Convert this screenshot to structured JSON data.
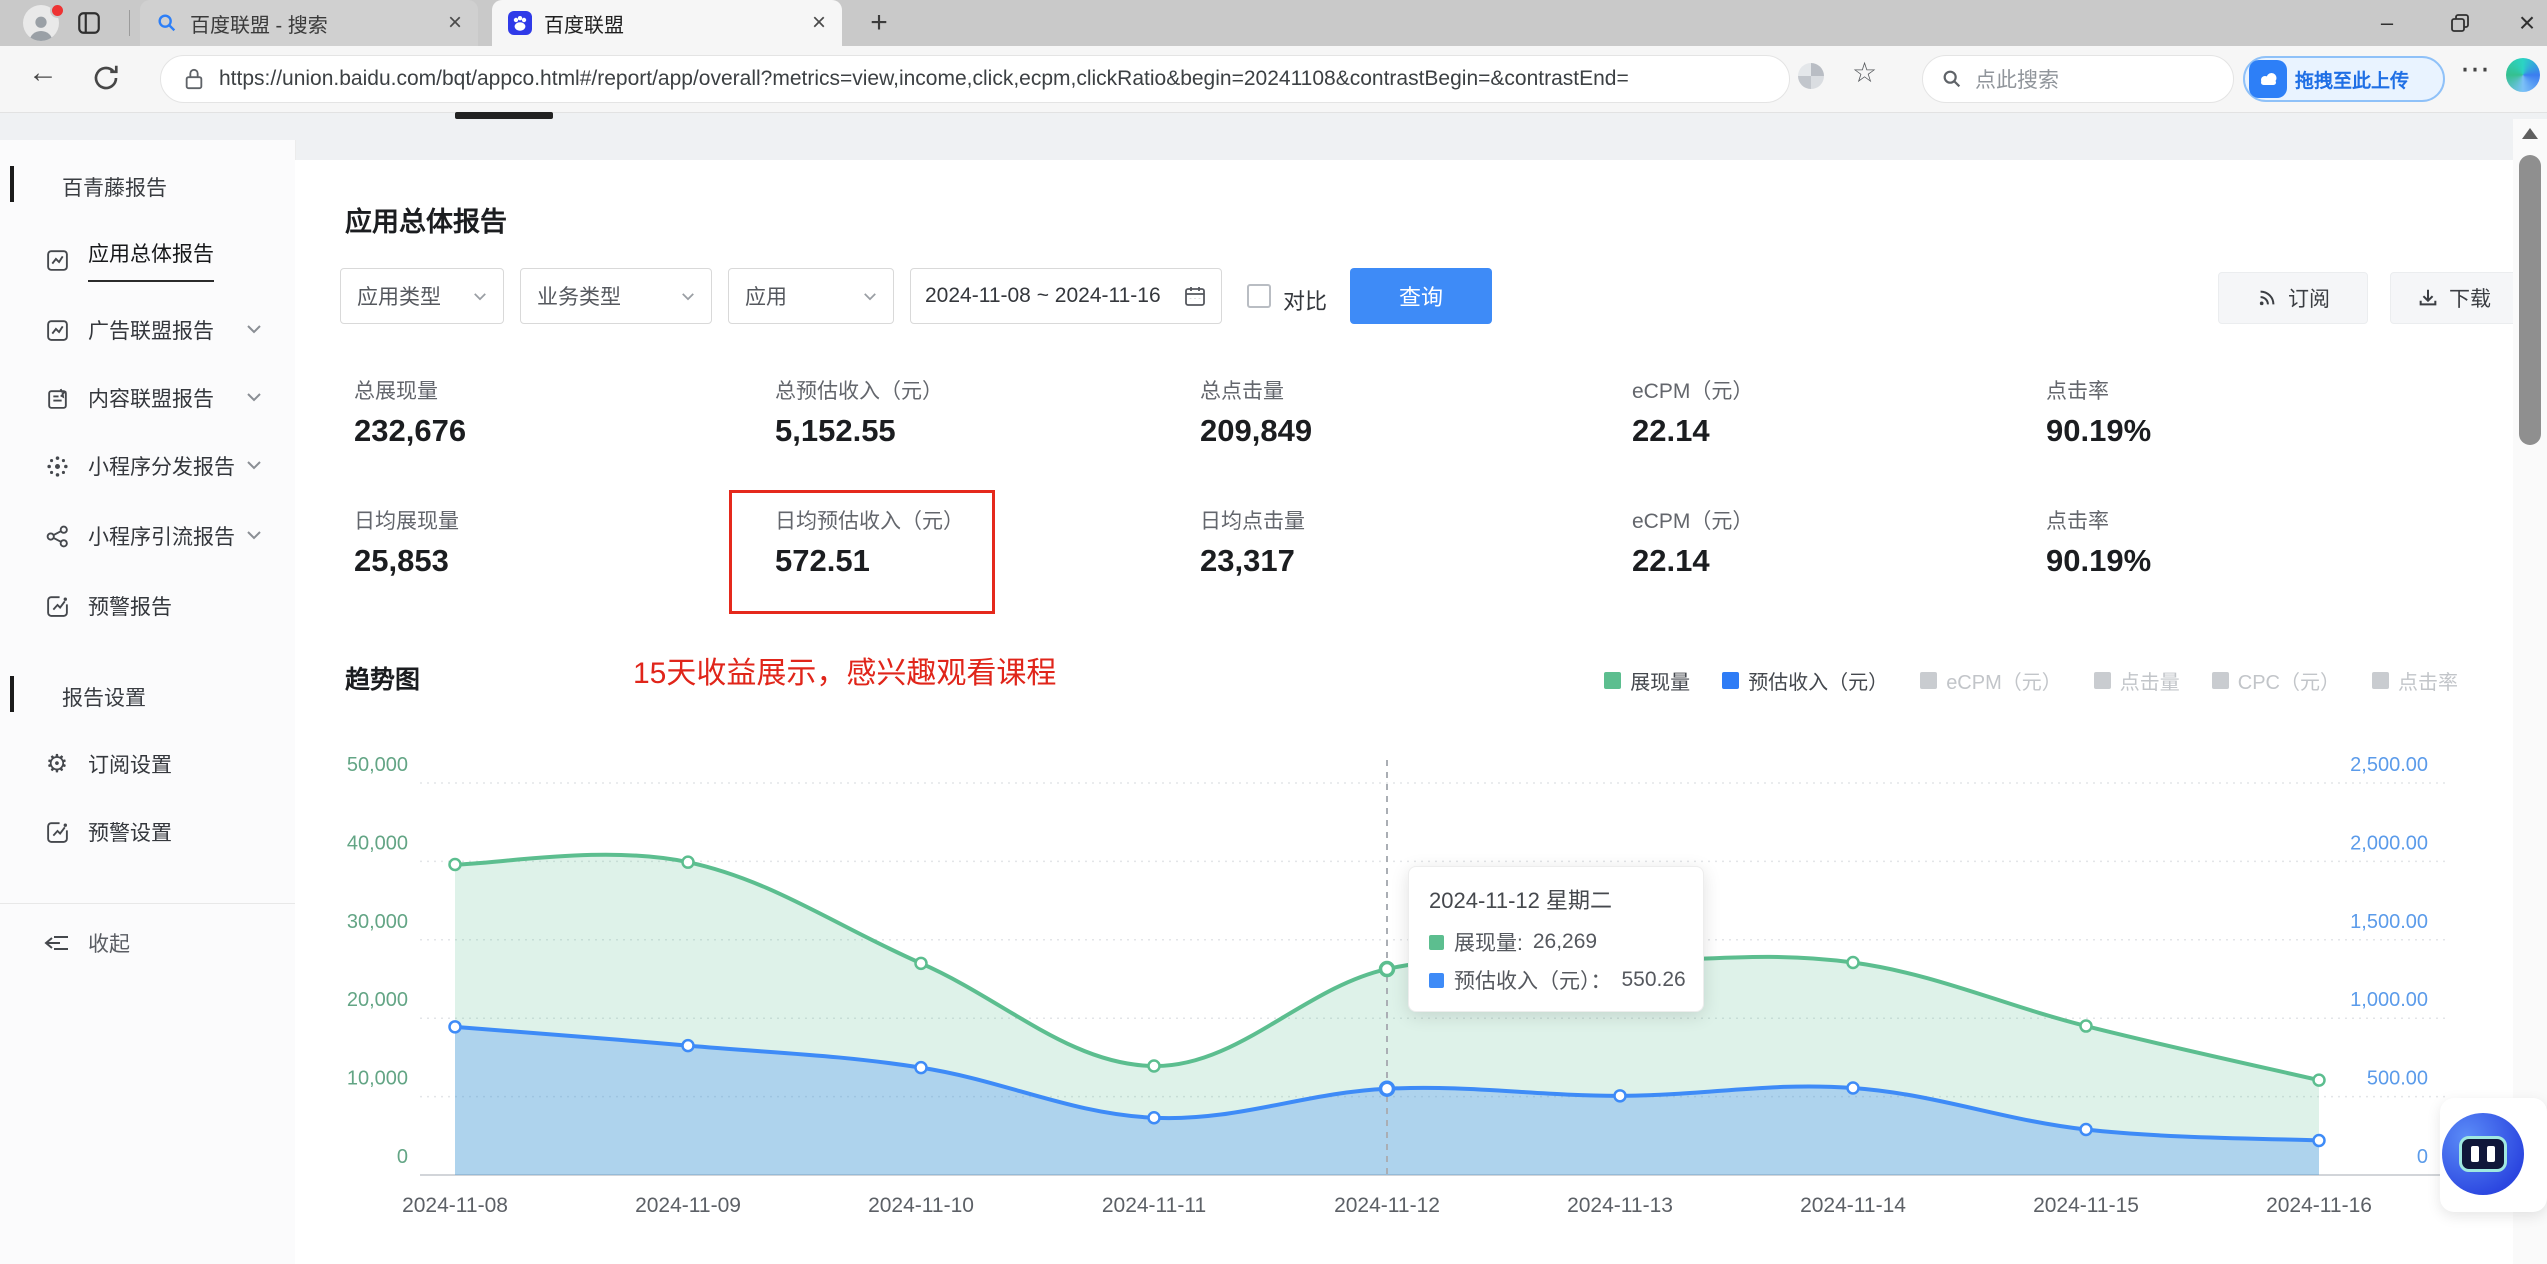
{
  "browser": {
    "tabs": [
      {
        "title": "百度联盟 - 搜索"
      },
      {
        "title": "百度联盟"
      }
    ],
    "url": "https://union.baidu.com/bqt/appco.html#/report/app/overall?metrics=view,income,click,ecpm,clickRatio&begin=20241108&contrastBegin=&contrastEnd=",
    "search_placeholder": "点此搜索",
    "upload_button": "拖拽至此上传",
    "window_controls": {
      "minimize": "–",
      "restore": "",
      "close": "×"
    },
    "new_tab": "+",
    "close_tab": "×",
    "back": "←",
    "more": "⋯",
    "star": "☆"
  },
  "sidebar": {
    "group1": "百青藤报告",
    "items": [
      {
        "label": "应用总体报告"
      },
      {
        "label": "广告联盟报告"
      },
      {
        "label": "内容联盟报告"
      },
      {
        "label": "小程序分发报告"
      },
      {
        "label": "小程序引流报告"
      },
      {
        "label": "预警报告"
      }
    ],
    "group2": "报告设置",
    "settings_items": [
      {
        "label": "订阅设置"
      },
      {
        "label": "预警设置"
      }
    ],
    "collapse": "收起"
  },
  "main": {
    "title": "应用总体报告",
    "filters": {
      "app_type": "应用类型",
      "biz_type": "业务类型",
      "app": "应用",
      "date_range": "2024-11-08 ~ 2024-11-16",
      "compare_label": "对比",
      "query_label": "查询"
    },
    "actions": {
      "subscribe": "订阅",
      "download": "下载"
    },
    "stats_row1": [
      {
        "label": "总展现量",
        "value": "232,676"
      },
      {
        "label": "总预估收入（元）",
        "value": "5,152.55"
      },
      {
        "label": "总点击量",
        "value": "209,849"
      },
      {
        "label": "eCPM（元）",
        "value": "22.14"
      },
      {
        "label": "点击率",
        "value": "90.19%"
      }
    ],
    "stats_row2": [
      {
        "label": "日均展现量",
        "value": "25,853"
      },
      {
        "label": "日均预估收入（元）",
        "value": "572.51"
      },
      {
        "label": "日均点击量",
        "value": "23,317"
      },
      {
        "label": "eCPM（元）",
        "value": "22.14"
      },
      {
        "label": "点击率",
        "value": "90.19%"
      }
    ],
    "annotation": "15天收益展示，感兴趣观看课程",
    "chart_title": "趋势图"
  },
  "chart_data": {
    "type": "area",
    "title": "趋势图",
    "categories": [
      "2024-11-08",
      "2024-11-09",
      "2024-11-10",
      "2024-11-11",
      "2024-11-12",
      "2024-11-13",
      "2024-11-14",
      "2024-11-15",
      "2024-11-16"
    ],
    "series": [
      {
        "name": "展现量",
        "axis": "left",
        "color": "#5CBE8F",
        "fill": "rgba(92,190,143,0.20)",
        "values": [
          39600,
          39900,
          27000,
          13900,
          26269,
          27200,
          27100,
          19000,
          12100
        ]
      },
      {
        "name": "预估收入（元）",
        "axis": "right",
        "color": "#3E8BF7",
        "fill": "rgba(62,139,247,0.30)",
        "values": [
          945,
          825,
          685,
          365,
          550.26,
          505,
          555,
          290,
          220
        ]
      }
    ],
    "disabled_legend": [
      "eCPM（元）",
      "点击量",
      "CPC（元）",
      "点击率"
    ],
    "y_left": {
      "min": 0,
      "max": 50000,
      "step": 10000
    },
    "y_right": {
      "min": 0,
      "max": 2500,
      "step": 500
    },
    "grid": true,
    "legend_position": "top-right",
    "tooltip": {
      "title": "2024-11-12 星期二",
      "x_index": 4,
      "rows": [
        {
          "label": "展现量:",
          "value": "26,269"
        },
        {
          "label": "预估收入（元）：",
          "value": "550.26"
        }
      ]
    }
  }
}
